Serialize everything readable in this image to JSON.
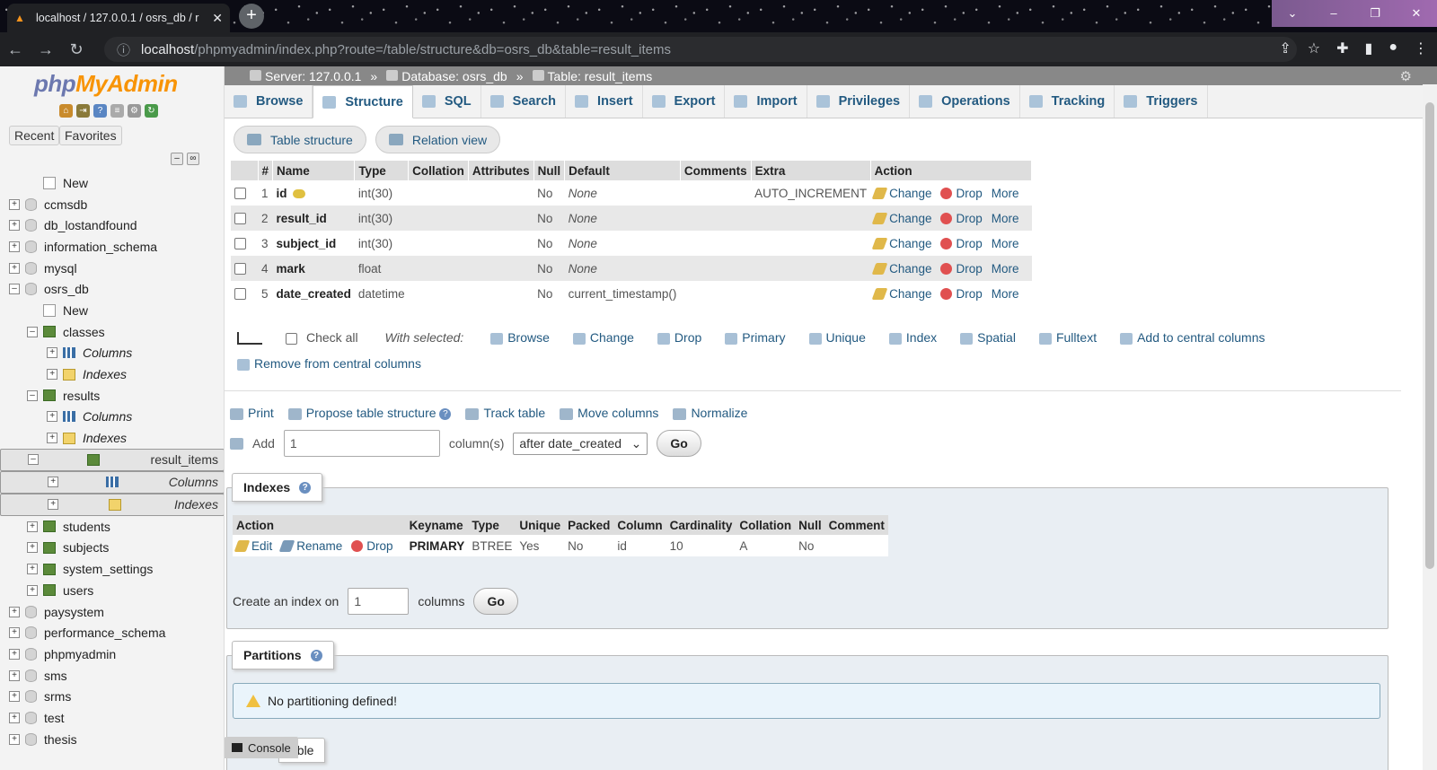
{
  "browser": {
    "tab_title": "localhost / 127.0.0.1 / osrs_db / r",
    "url_host": "localhost",
    "url_path": "/phpmyadmin/index.php?route=/table/structure&db=osrs_db&table=result_items"
  },
  "sidebar": {
    "logo_php": "php",
    "logo_myadmin": "MyAdmin",
    "recent_label": "Recent",
    "favorites_label": "Favorites",
    "tree": [
      {
        "label": "New",
        "level": 1,
        "kind": "new"
      },
      {
        "label": "ccmsdb",
        "level": 0,
        "kind": "db"
      },
      {
        "label": "db_lostandfound",
        "level": 0,
        "kind": "db"
      },
      {
        "label": "information_schema",
        "level": 0,
        "kind": "db"
      },
      {
        "label": "mysql",
        "level": 0,
        "kind": "db"
      },
      {
        "label": "osrs_db",
        "level": 0,
        "kind": "db",
        "expanded": true
      },
      {
        "label": "New",
        "level": 1,
        "kind": "new"
      },
      {
        "label": "classes",
        "level": 1,
        "kind": "table",
        "expanded": true
      },
      {
        "label": "Columns",
        "level": 2,
        "kind": "col"
      },
      {
        "label": "Indexes",
        "level": 2,
        "kind": "idx"
      },
      {
        "label": "results",
        "level": 1,
        "kind": "table",
        "expanded": true
      },
      {
        "label": "Columns",
        "level": 2,
        "kind": "col"
      },
      {
        "label": "Indexes",
        "level": 2,
        "kind": "idx"
      },
      {
        "label": "result_items",
        "level": 1,
        "kind": "table",
        "expanded": true,
        "selected": true
      },
      {
        "label": "Columns",
        "level": 2,
        "kind": "col",
        "selected": true
      },
      {
        "label": "Indexes",
        "level": 2,
        "kind": "idx",
        "selected": true
      },
      {
        "label": "students",
        "level": 1,
        "kind": "table"
      },
      {
        "label": "subjects",
        "level": 1,
        "kind": "table"
      },
      {
        "label": "system_settings",
        "level": 1,
        "kind": "table"
      },
      {
        "label": "users",
        "level": 1,
        "kind": "table"
      },
      {
        "label": "paysystem",
        "level": 0,
        "kind": "db"
      },
      {
        "label": "performance_schema",
        "level": 0,
        "kind": "db"
      },
      {
        "label": "phpmyadmin",
        "level": 0,
        "kind": "db"
      },
      {
        "label": "sms",
        "level": 0,
        "kind": "db"
      },
      {
        "label": "srms",
        "level": 0,
        "kind": "db"
      },
      {
        "label": "test",
        "level": 0,
        "kind": "db"
      },
      {
        "label": "thesis",
        "level": 0,
        "kind": "db"
      }
    ]
  },
  "breadcrumb": {
    "server": "Server: 127.0.0.1",
    "database": "Database: osrs_db",
    "table": "Table: result_items",
    "sep": "»"
  },
  "tabs": [
    "Browse",
    "Structure",
    "SQL",
    "Search",
    "Insert",
    "Export",
    "Import",
    "Privileges",
    "Operations",
    "Tracking",
    "Triggers"
  ],
  "active_tab": "Structure",
  "subtabs": {
    "table_structure": "Table structure",
    "relation_view": "Relation view"
  },
  "structure": {
    "headers": [
      "#",
      "Name",
      "Type",
      "Collation",
      "Attributes",
      "Null",
      "Default",
      "Comments",
      "Extra",
      "Action"
    ],
    "rows": [
      {
        "num": "1",
        "name": "id",
        "type": "int(30)",
        "null": "No",
        "default": "None",
        "extra": "AUTO_INCREMENT",
        "key": true
      },
      {
        "num": "2",
        "name": "result_id",
        "type": "int(30)",
        "null": "No",
        "default": "None",
        "extra": ""
      },
      {
        "num": "3",
        "name": "subject_id",
        "type": "int(30)",
        "null": "No",
        "default": "None",
        "extra": ""
      },
      {
        "num": "4",
        "name": "mark",
        "type": "float",
        "null": "No",
        "default": "None",
        "extra": ""
      },
      {
        "num": "5",
        "name": "date_created",
        "type": "datetime",
        "null": "No",
        "default": "current_timestamp()",
        "extra": ""
      }
    ],
    "action_change": "Change",
    "action_drop": "Drop",
    "action_more": "More"
  },
  "with_selected": {
    "check_all": "Check all",
    "label": "With selected:",
    "actions": [
      "Browse",
      "Change",
      "Drop",
      "Primary",
      "Unique",
      "Index",
      "Spatial",
      "Fulltext",
      "Add to central columns"
    ],
    "remove_central": "Remove from central columns"
  },
  "tools": {
    "print": "Print",
    "propose": "Propose table structure",
    "track": "Track table",
    "move": "Move columns",
    "normalize": "Normalize"
  },
  "add_column": {
    "label": "Add",
    "value": "1",
    "suffix": "column(s)",
    "position": "after date_created",
    "go": "Go"
  },
  "indexes": {
    "legend": "Indexes",
    "headers": [
      "Action",
      "Keyname",
      "Type",
      "Unique",
      "Packed",
      "Column",
      "Cardinality",
      "Collation",
      "Null",
      "Comment"
    ],
    "row": {
      "edit": "Edit",
      "rename": "Rename",
      "drop": "Drop",
      "keyname": "PRIMARY",
      "type": "BTREE",
      "unique": "Yes",
      "packed": "No",
      "column": "id",
      "cardinality": "10",
      "collation": "A",
      "null": "No",
      "comment": ""
    },
    "create_label": "Create an index on",
    "create_value": "1",
    "columns_label": "columns",
    "go": "Go"
  },
  "partitions": {
    "legend": "Partitions",
    "notice": "No partitioning defined!"
  },
  "console": {
    "label": "Console",
    "behind": "able"
  }
}
